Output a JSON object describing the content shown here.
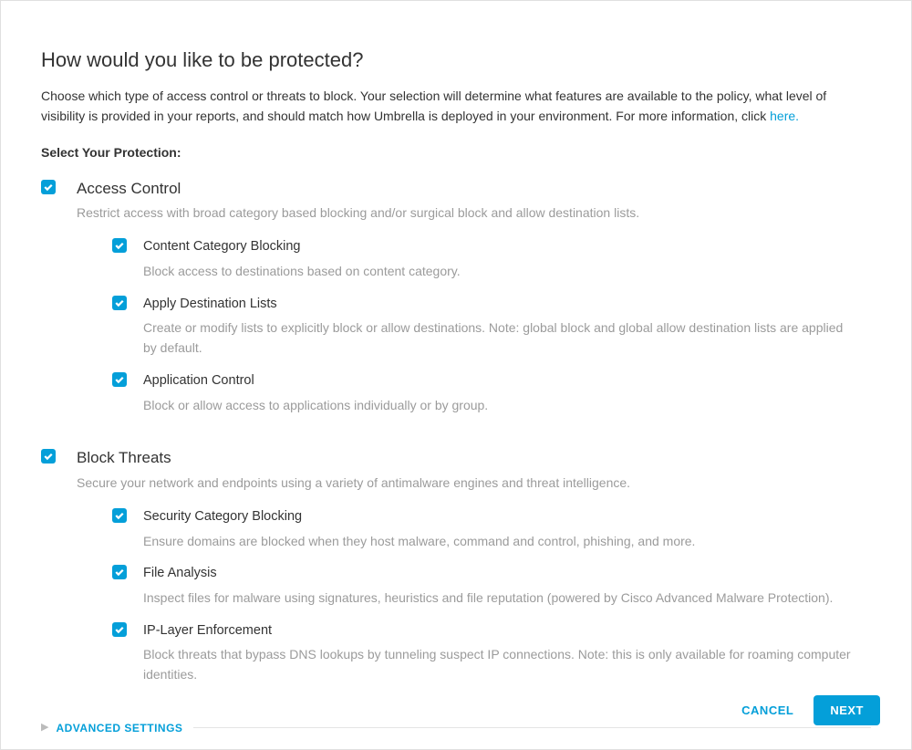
{
  "heading": "How would you like to be protected?",
  "intro_text": "Choose which type of access control or threats to block. Your selection will determine what features are available to the policy, what level of visibility is provided in your reports, and should match how Umbrella is deployed in your environment. For more information, click ",
  "intro_link": "here.",
  "select_label": "Select Your Protection:",
  "groups": [
    {
      "title": "Access Control",
      "desc": "Restrict access with broad category based blocking and/or surgical block and allow destination lists.",
      "items": [
        {
          "title": "Content Category Blocking",
          "desc": "Block access to destinations based on content category."
        },
        {
          "title": "Apply Destination Lists",
          "desc": "Create or modify lists to explicitly block or allow destinations. Note: global block and global allow destination lists are applied by default."
        },
        {
          "title": "Application Control",
          "desc": "Block or allow access to applications individually or by group."
        }
      ]
    },
    {
      "title": "Block Threats",
      "desc": "Secure your network and endpoints using a variety of antimalware engines and threat intelligence.",
      "items": [
        {
          "title": "Security Category Blocking",
          "desc": "Ensure domains are blocked when they host malware, command and control, phishing, and more."
        },
        {
          "title": "File Analysis",
          "desc": "Inspect files for malware using signatures, heuristics and file reputation (powered by Cisco Advanced Malware Protection)."
        },
        {
          "title": "IP-Layer Enforcement",
          "desc": "Block threats that bypass DNS lookups by tunneling suspect IP connections. Note: this is only available for roaming computer identities."
        }
      ]
    }
  ],
  "advanced_label": "ADVANCED SETTINGS",
  "buttons": {
    "cancel": "CANCEL",
    "next": "NEXT"
  }
}
